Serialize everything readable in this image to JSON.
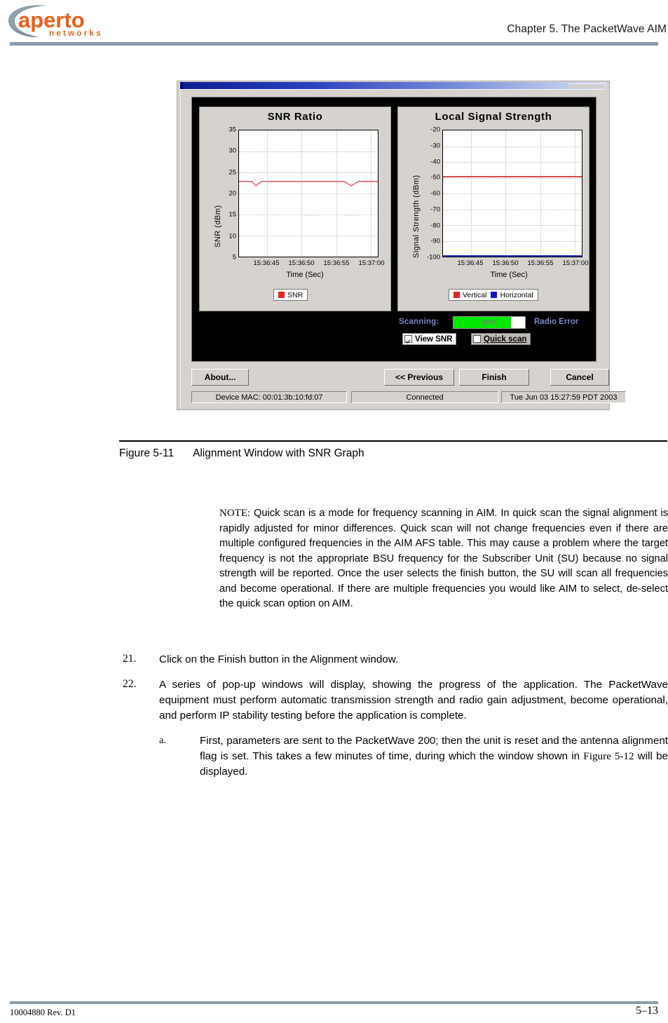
{
  "header": {
    "logo_primary": "aperto",
    "logo_secondary": "networks",
    "logo_color": "#e8601c",
    "logo_arc_color": "#8fa0ad",
    "chapter_title": "Chapter 5.  The PacketWave AIM",
    "rule_color": "#8a9bab"
  },
  "figure": {
    "caption_label": "Figure 5-11",
    "caption_text": "Alignment Window with SNR Graph",
    "dialog": {
      "charts": [
        {
          "title": "SNR Ratio",
          "legend": [
            {
              "label": "SNR",
              "color": "#ee2222"
            }
          ]
        },
        {
          "title": "Local Signal Strength",
          "legend": [
            {
              "label": "Vertical",
              "color": "#ee2222"
            },
            {
              "label": "Horizontal",
              "color": "#1111cc"
            }
          ]
        }
      ],
      "controls": {
        "scanning_label": "Scanning:",
        "progress_value": "80%",
        "progress_percent": 80,
        "progress_color": "#00e800",
        "radio_error_label": "Radio Error",
        "label_color": "#7b86c9",
        "view_snr_label": "View SNR",
        "view_snr_checked": true,
        "quick_scan_label": "Quick scan",
        "quick_scan_checked": false
      },
      "buttons": {
        "about": "About...",
        "previous": "<< Previous",
        "finish": "Finish",
        "cancel": "Cancel"
      },
      "status": {
        "device_mac": "Device MAC: 00:01:3b:10:fd:07",
        "connection": "Connected",
        "timestamp": "Tue Jun 03 15:27:59 PDT 2003"
      }
    }
  },
  "chart_data": [
    {
      "type": "line",
      "title": "SNR Ratio",
      "xlabel": "Time (Sec)",
      "ylabel": "SNR (dBm)",
      "ylim": [
        5,
        35
      ],
      "yticks": [
        35,
        30,
        25,
        20,
        15,
        10,
        5
      ],
      "xticks": [
        "15:36:45",
        "15:36:50",
        "15:36:55",
        "15:37:00"
      ],
      "grid": true,
      "legend_position": "bottom",
      "series": [
        {
          "name": "SNR",
          "color": "#ee2222",
          "values": [
            23,
            23,
            23,
            22,
            23,
            23,
            23,
            23,
            23,
            23,
            23,
            23,
            23,
            23,
            23,
            23,
            23,
            23,
            23,
            23,
            23,
            23,
            23,
            23,
            23,
            23,
            23,
            23,
            23,
            23,
            23,
            23,
            23,
            23,
            22,
            23,
            23,
            23
          ]
        }
      ]
    },
    {
      "type": "line",
      "title": "Local Signal Strength",
      "xlabel": "Time (Sec)",
      "ylabel": "Signal Strength (dBm)",
      "ylim": [
        -100,
        -20
      ],
      "yticks": [
        -20,
        -30,
        -40,
        -50,
        -60,
        -70,
        -80,
        -90,
        -100
      ],
      "xticks": [
        "15:36:45",
        "15:36:50",
        "15:36:55",
        "15:37:00"
      ],
      "grid": true,
      "legend_position": "bottom",
      "series": [
        {
          "name": "Vertical",
          "color": "#ee2222",
          "value": -49
        },
        {
          "name": "Horizontal",
          "color": "#1111cc",
          "value": -100
        }
      ]
    }
  ],
  "body": {
    "note_prefix": "NOTE:",
    "note_text": "  Quick scan is a mode for frequency scanning in AIM. In quick scan the signal alignment is rapidly adjusted for minor differences. Quick scan will not change frequencies even if there are multiple configured frequencies in the AIM AFS table. This may cause a problem where the target frequency is not the appropriate BSU frequency for the Subscriber Unit (SU) because no signal strength will be reported. Once the user selects the finish button, the SU will scan all frequencies and become operational.  If there are multiple frequencies you would like AIM to select, de-select the quick scan option on AIM.",
    "items": [
      {
        "num": "21.",
        "text": "Click on the Finish button in the Alignment window."
      },
      {
        "num": "22.",
        "text": "A series of pop-up windows will display, showing the progress of the application. The PacketWave equipment must perform automatic transmission strength and radio gain adjustment, become operational, and perform IP stability testing before the application is complete."
      }
    ],
    "subitem": {
      "num": "a.",
      "text_before": "First, parameters are sent to the PacketWave 200; then the unit is reset and the antenna alignment flag is set. This takes a few minutes of time, during which the window shown in ",
      "xref": "Figure 5-12",
      "text_after": " will be displayed."
    }
  },
  "footer": {
    "doc_id": "10004880 Rev. D1",
    "page_number": "5–13",
    "rule_color": "#8a9bab"
  }
}
